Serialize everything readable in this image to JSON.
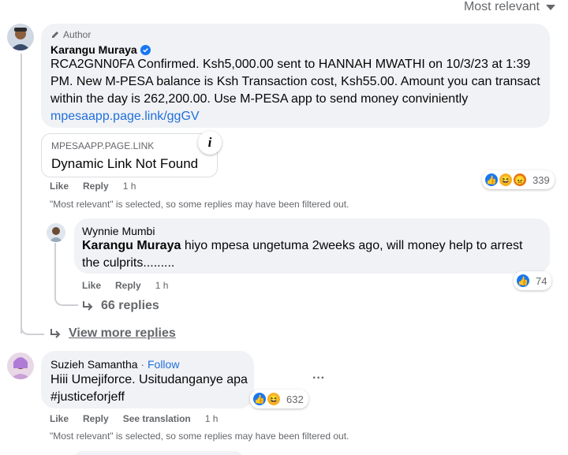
{
  "sort": {
    "label": "Most relevant"
  },
  "comment1": {
    "author_badge": "Author",
    "name": "Karangu Muraya",
    "text_lines": [
      "RCA2GNN0FA Confirmed. Ksh5,000.00 sent to HANNAH MWATHI on 10/3/23 at 1:39",
      "PM. New M-PESA balance is Ksh Transaction cost, Ksh55.00. Amount you can transact",
      "within the day is 262,200.00. Use M-PESA app to send money conviniently"
    ],
    "link": "mpesaapp.page.link/ggGV",
    "preview": {
      "domain": "MPESAAPP.PAGE.LINK",
      "title": "Dynamic Link Not Found",
      "info": "i"
    },
    "actions": {
      "like": "Like",
      "reply": "Reply",
      "time": "1 h"
    },
    "reaction_count": "339",
    "filter_note": "\"Most relevant\" is selected, so some replies may have been filtered out."
  },
  "reply1": {
    "name": "Wynnie Mumbi",
    "mention": "Karangu Muraya",
    "text_line1": " hiyo mpesa ungetuma 2weeks ago, will money help to arrest",
    "text_line2": "the culprits.........",
    "actions": {
      "like": "Like",
      "reply": "Reply",
      "time": "1 h"
    },
    "reaction_count": "74",
    "more_replies": "66 replies"
  },
  "view_more": "View more replies",
  "comment2": {
    "name": "Suzieh Samantha",
    "separator": " · ",
    "follow": "Follow",
    "line1": "Hiii Umejiforce. Usitudanganye apa",
    "line2": "#justiceforjeff",
    "more": "···",
    "reaction_count": "632",
    "actions": {
      "like": "Like",
      "reply": "Reply",
      "translate": "See translation",
      "time": "1 h"
    },
    "filter_note": "\"Most relevant\" is selected, so some replies may have been filtered out."
  },
  "colors": {
    "link": "#216fdb",
    "bubble": "#f0f2f5",
    "muted": "#65676b",
    "verified": "#1877f2"
  }
}
